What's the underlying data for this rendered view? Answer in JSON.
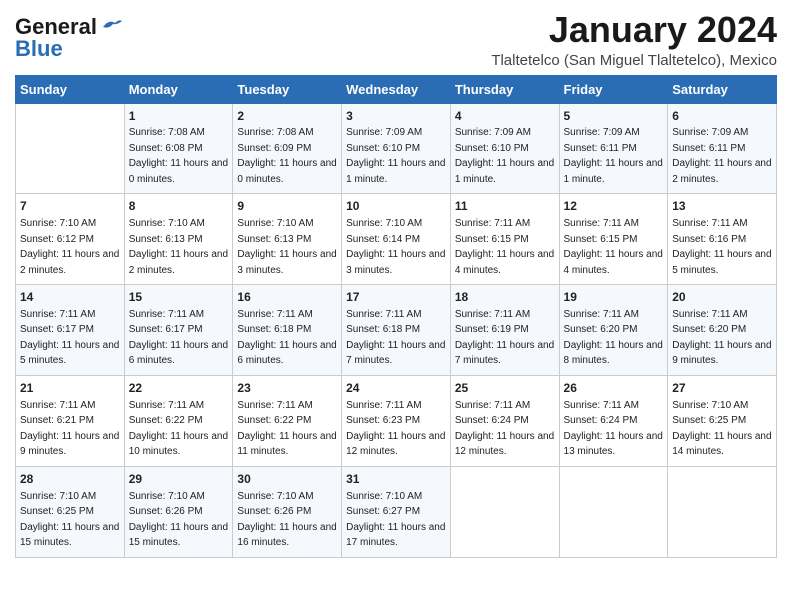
{
  "header": {
    "logo_line1": "General",
    "logo_line2": "Blue",
    "month": "January 2024",
    "location": "Tlaltetelco (San Miguel Tlaltetelco), Mexico"
  },
  "weekdays": [
    "Sunday",
    "Monday",
    "Tuesday",
    "Wednesday",
    "Thursday",
    "Friday",
    "Saturday"
  ],
  "weeks": [
    [
      {
        "day": "",
        "sunrise": "",
        "sunset": "",
        "daylight": ""
      },
      {
        "day": "1",
        "sunrise": "7:08 AM",
        "sunset": "6:08 PM",
        "daylight": "11 hours and 0 minutes."
      },
      {
        "day": "2",
        "sunrise": "7:08 AM",
        "sunset": "6:09 PM",
        "daylight": "11 hours and 0 minutes."
      },
      {
        "day": "3",
        "sunrise": "7:09 AM",
        "sunset": "6:10 PM",
        "daylight": "11 hours and 1 minute."
      },
      {
        "day": "4",
        "sunrise": "7:09 AM",
        "sunset": "6:10 PM",
        "daylight": "11 hours and 1 minute."
      },
      {
        "day": "5",
        "sunrise": "7:09 AM",
        "sunset": "6:11 PM",
        "daylight": "11 hours and 1 minute."
      },
      {
        "day": "6",
        "sunrise": "7:09 AM",
        "sunset": "6:11 PM",
        "daylight": "11 hours and 2 minutes."
      }
    ],
    [
      {
        "day": "7",
        "sunrise": "7:10 AM",
        "sunset": "6:12 PM",
        "daylight": "11 hours and 2 minutes."
      },
      {
        "day": "8",
        "sunrise": "7:10 AM",
        "sunset": "6:13 PM",
        "daylight": "11 hours and 2 minutes."
      },
      {
        "day": "9",
        "sunrise": "7:10 AM",
        "sunset": "6:13 PM",
        "daylight": "11 hours and 3 minutes."
      },
      {
        "day": "10",
        "sunrise": "7:10 AM",
        "sunset": "6:14 PM",
        "daylight": "11 hours and 3 minutes."
      },
      {
        "day": "11",
        "sunrise": "7:11 AM",
        "sunset": "6:15 PM",
        "daylight": "11 hours and 4 minutes."
      },
      {
        "day": "12",
        "sunrise": "7:11 AM",
        "sunset": "6:15 PM",
        "daylight": "11 hours and 4 minutes."
      },
      {
        "day": "13",
        "sunrise": "7:11 AM",
        "sunset": "6:16 PM",
        "daylight": "11 hours and 5 minutes."
      }
    ],
    [
      {
        "day": "14",
        "sunrise": "7:11 AM",
        "sunset": "6:17 PM",
        "daylight": "11 hours and 5 minutes."
      },
      {
        "day": "15",
        "sunrise": "7:11 AM",
        "sunset": "6:17 PM",
        "daylight": "11 hours and 6 minutes."
      },
      {
        "day": "16",
        "sunrise": "7:11 AM",
        "sunset": "6:18 PM",
        "daylight": "11 hours and 6 minutes."
      },
      {
        "day": "17",
        "sunrise": "7:11 AM",
        "sunset": "6:18 PM",
        "daylight": "11 hours and 7 minutes."
      },
      {
        "day": "18",
        "sunrise": "7:11 AM",
        "sunset": "6:19 PM",
        "daylight": "11 hours and 7 minutes."
      },
      {
        "day": "19",
        "sunrise": "7:11 AM",
        "sunset": "6:20 PM",
        "daylight": "11 hours and 8 minutes."
      },
      {
        "day": "20",
        "sunrise": "7:11 AM",
        "sunset": "6:20 PM",
        "daylight": "11 hours and 9 minutes."
      }
    ],
    [
      {
        "day": "21",
        "sunrise": "7:11 AM",
        "sunset": "6:21 PM",
        "daylight": "11 hours and 9 minutes."
      },
      {
        "day": "22",
        "sunrise": "7:11 AM",
        "sunset": "6:22 PM",
        "daylight": "11 hours and 10 minutes."
      },
      {
        "day": "23",
        "sunrise": "7:11 AM",
        "sunset": "6:22 PM",
        "daylight": "11 hours and 11 minutes."
      },
      {
        "day": "24",
        "sunrise": "7:11 AM",
        "sunset": "6:23 PM",
        "daylight": "11 hours and 12 minutes."
      },
      {
        "day": "25",
        "sunrise": "7:11 AM",
        "sunset": "6:24 PM",
        "daylight": "11 hours and 12 minutes."
      },
      {
        "day": "26",
        "sunrise": "7:11 AM",
        "sunset": "6:24 PM",
        "daylight": "11 hours and 13 minutes."
      },
      {
        "day": "27",
        "sunrise": "7:10 AM",
        "sunset": "6:25 PM",
        "daylight": "11 hours and 14 minutes."
      }
    ],
    [
      {
        "day": "28",
        "sunrise": "7:10 AM",
        "sunset": "6:25 PM",
        "daylight": "11 hours and 15 minutes."
      },
      {
        "day": "29",
        "sunrise": "7:10 AM",
        "sunset": "6:26 PM",
        "daylight": "11 hours and 15 minutes."
      },
      {
        "day": "30",
        "sunrise": "7:10 AM",
        "sunset": "6:26 PM",
        "daylight": "11 hours and 16 minutes."
      },
      {
        "day": "31",
        "sunrise": "7:10 AM",
        "sunset": "6:27 PM",
        "daylight": "11 hours and 17 minutes."
      },
      {
        "day": "",
        "sunrise": "",
        "sunset": "",
        "daylight": ""
      },
      {
        "day": "",
        "sunrise": "",
        "sunset": "",
        "daylight": ""
      },
      {
        "day": "",
        "sunrise": "",
        "sunset": "",
        "daylight": ""
      }
    ]
  ]
}
